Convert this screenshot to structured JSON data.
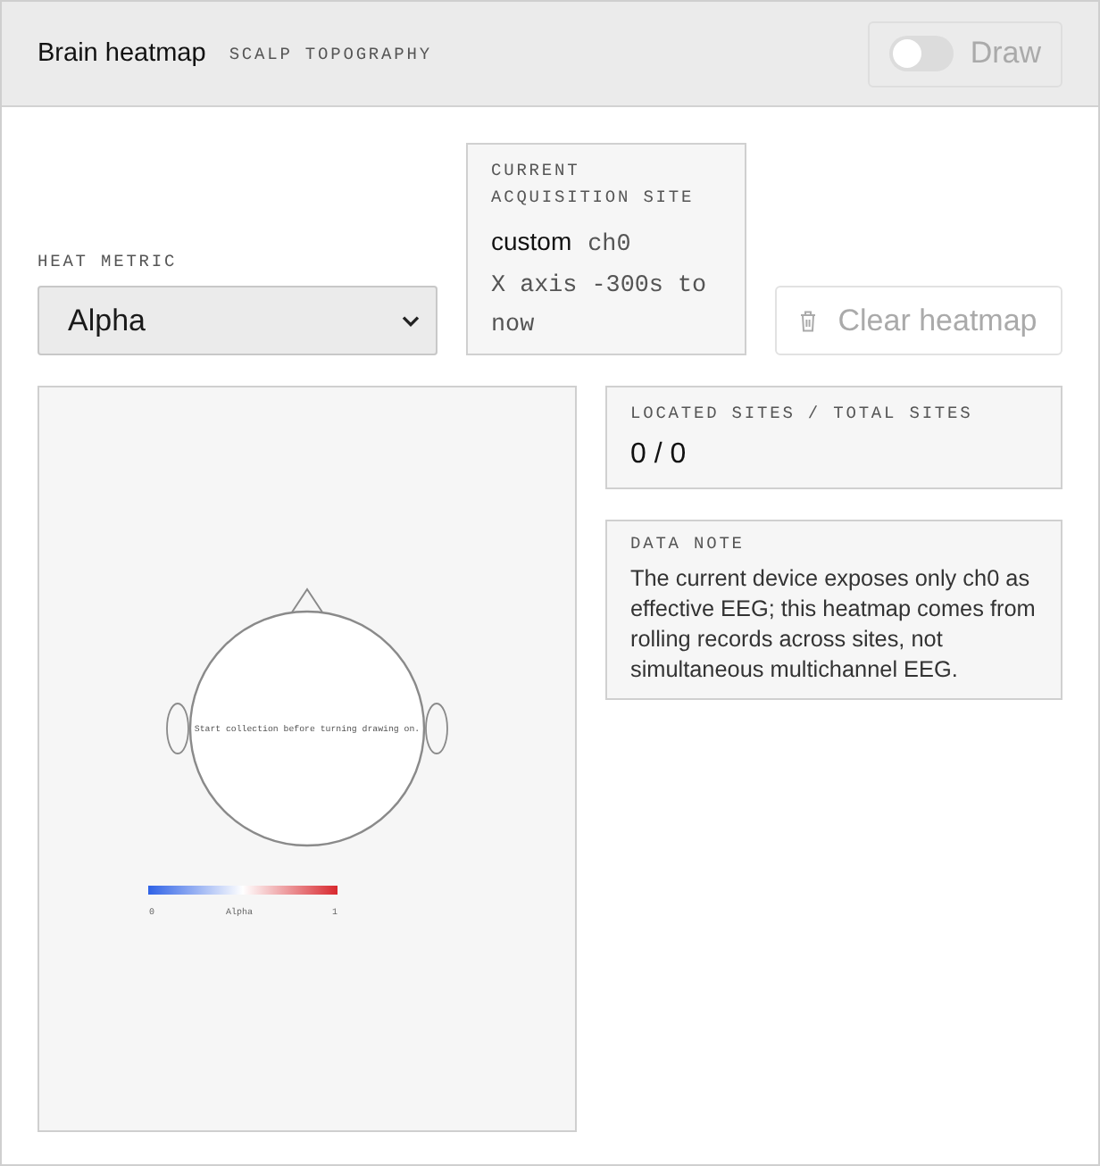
{
  "header": {
    "title": "Brain heatmap",
    "subtitle": "SCALP TOPOGRAPHY",
    "draw_toggle": {
      "label": "Draw",
      "on": false,
      "disabled": true
    }
  },
  "heat_metric": {
    "label": "HEAT METRIC",
    "value": "Alpha"
  },
  "acquisition_card": {
    "label": "CURRENT ACQUISITION SITE",
    "site": "custom",
    "channel": "ch0",
    "range": "X axis -300s to now"
  },
  "clear_button": {
    "label": "Clear heatmap",
    "disabled": true
  },
  "heatmap": {
    "message": "Start collection before turning drawing on.",
    "legend": {
      "min": "0",
      "metric": "Alpha",
      "max": "1"
    }
  },
  "sites_card": {
    "label": "LOCATED SITES / TOTAL SITES",
    "value": "0 / 0"
  },
  "note_card": {
    "label": "DATA NOTE",
    "text": "The current device exposes only ch0 as effective EEG; this heatmap comes from rolling records across sites, not simultaneous multichannel EEG."
  }
}
